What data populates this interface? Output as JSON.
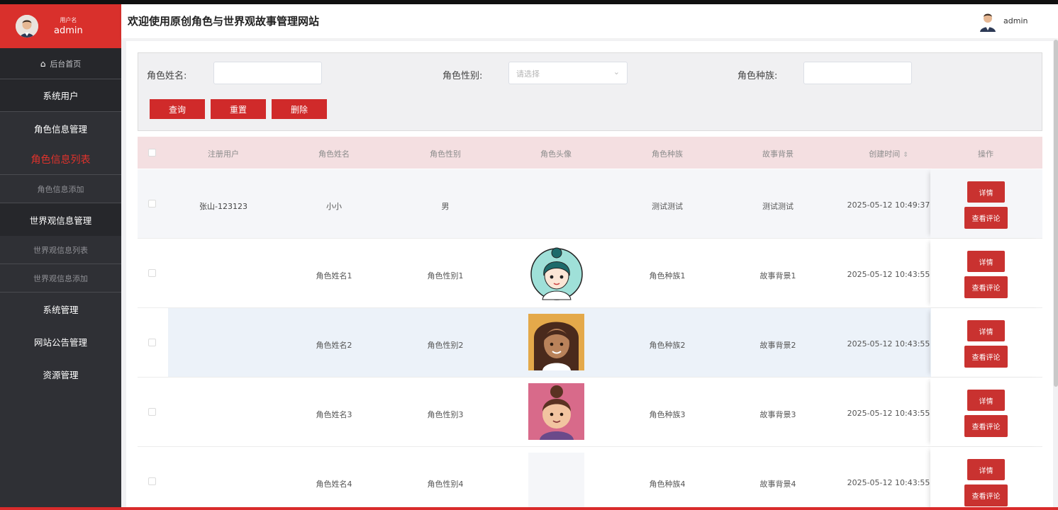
{
  "sidebar": {
    "user_caption": "用户名",
    "user_name": "admin",
    "items": [
      {
        "label": "后台首页"
      },
      {
        "label": "系统用户"
      },
      {
        "label": "角色信息管理"
      },
      {
        "label": "角色信息列表"
      },
      {
        "label": "角色信息添加"
      },
      {
        "label": "世界观信息管理"
      },
      {
        "label": "世界观信息列表"
      },
      {
        "label": "世界观信息添加"
      },
      {
        "label": "系统管理"
      },
      {
        "label": "网站公告管理"
      },
      {
        "label": "资源管理"
      }
    ]
  },
  "header": {
    "title": "欢迎使用原创角色与世界观故事管理网站",
    "user": "admin"
  },
  "search": {
    "name_label": "角色姓名:",
    "gender_label": "角色性别:",
    "gender_placeholder": "请选择",
    "race_label": "角色种族:",
    "query_btn": "查询",
    "reset_btn": "重置",
    "delete_btn": "删除"
  },
  "table": {
    "columns": [
      "注册用户",
      "角色姓名",
      "角色性别",
      "角色头像",
      "角色种族",
      "故事背景",
      "创建时间",
      "操作"
    ],
    "detail_btn": "详情",
    "comment_btn": "查看评论",
    "rows": [
      {
        "user": "张山-123123",
        "name": "小小",
        "gender": "男",
        "race": "测试测试",
        "story": "测试测试",
        "created": "2025-05-12 10:49:37"
      },
      {
        "user": "",
        "name": "角色姓名1",
        "gender": "角色性别1",
        "race": "角色种族1",
        "story": "故事背景1",
        "created": "2025-05-12 10:43:55"
      },
      {
        "user": "",
        "name": "角色姓名2",
        "gender": "角色性别2",
        "race": "角色种族2",
        "story": "故事背景2",
        "created": "2025-05-12 10:43:55"
      },
      {
        "user": "",
        "name": "角色姓名3",
        "gender": "角色性别3",
        "race": "角色种族3",
        "story": "故事背景3",
        "created": "2025-05-12 10:43:55"
      },
      {
        "user": "",
        "name": "角色姓名4",
        "gender": "角色性别4",
        "race": "角色种族4",
        "story": "故事背景4",
        "created": "2025-05-12 10:43:55"
      }
    ]
  },
  "colors": {
    "accent": "#d9302c",
    "sidebar": "#2f3035",
    "table_header": "#f4dfe1"
  }
}
